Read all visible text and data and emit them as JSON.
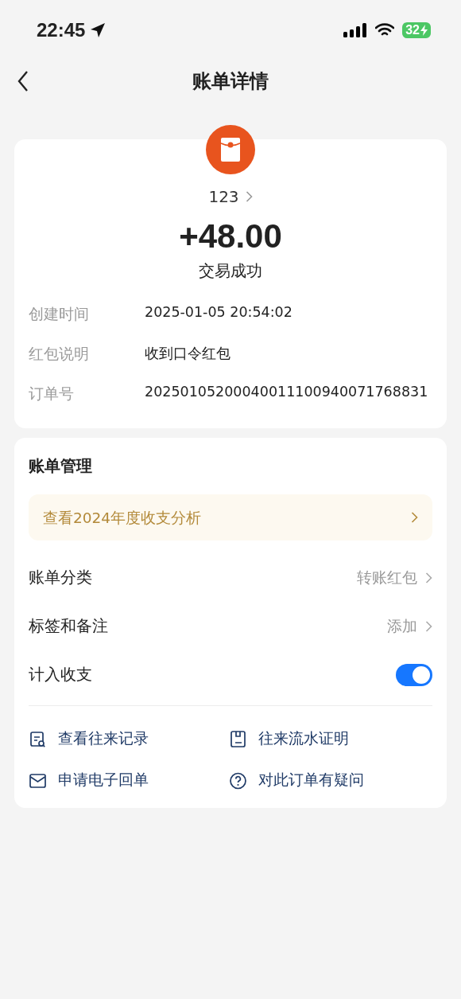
{
  "status_bar": {
    "time": "22:45",
    "battery": "32"
  },
  "header": {
    "title": "账单详情"
  },
  "summary": {
    "payer": "123",
    "amount": "+48.00",
    "status": "交易成功",
    "details": [
      {
        "label": "创建时间",
        "value": "2025-01-05 20:54:02"
      },
      {
        "label": "红包说明",
        "value": "收到口令红包"
      },
      {
        "label": "订单号",
        "value": "20250105200040011100940071768831"
      }
    ]
  },
  "management": {
    "title": "账单管理",
    "banner": "查看2024年度收支分析",
    "rows": [
      {
        "kind": "link",
        "label": "账单分类",
        "value": "转账红包"
      },
      {
        "kind": "link",
        "label": "标签和备注",
        "value": "添加"
      },
      {
        "kind": "toggle",
        "label": "计入收支",
        "on": true
      }
    ],
    "actions": [
      "查看往来记录",
      "往来流水证明",
      "申请电子回单",
      "对此订单有疑问"
    ]
  }
}
